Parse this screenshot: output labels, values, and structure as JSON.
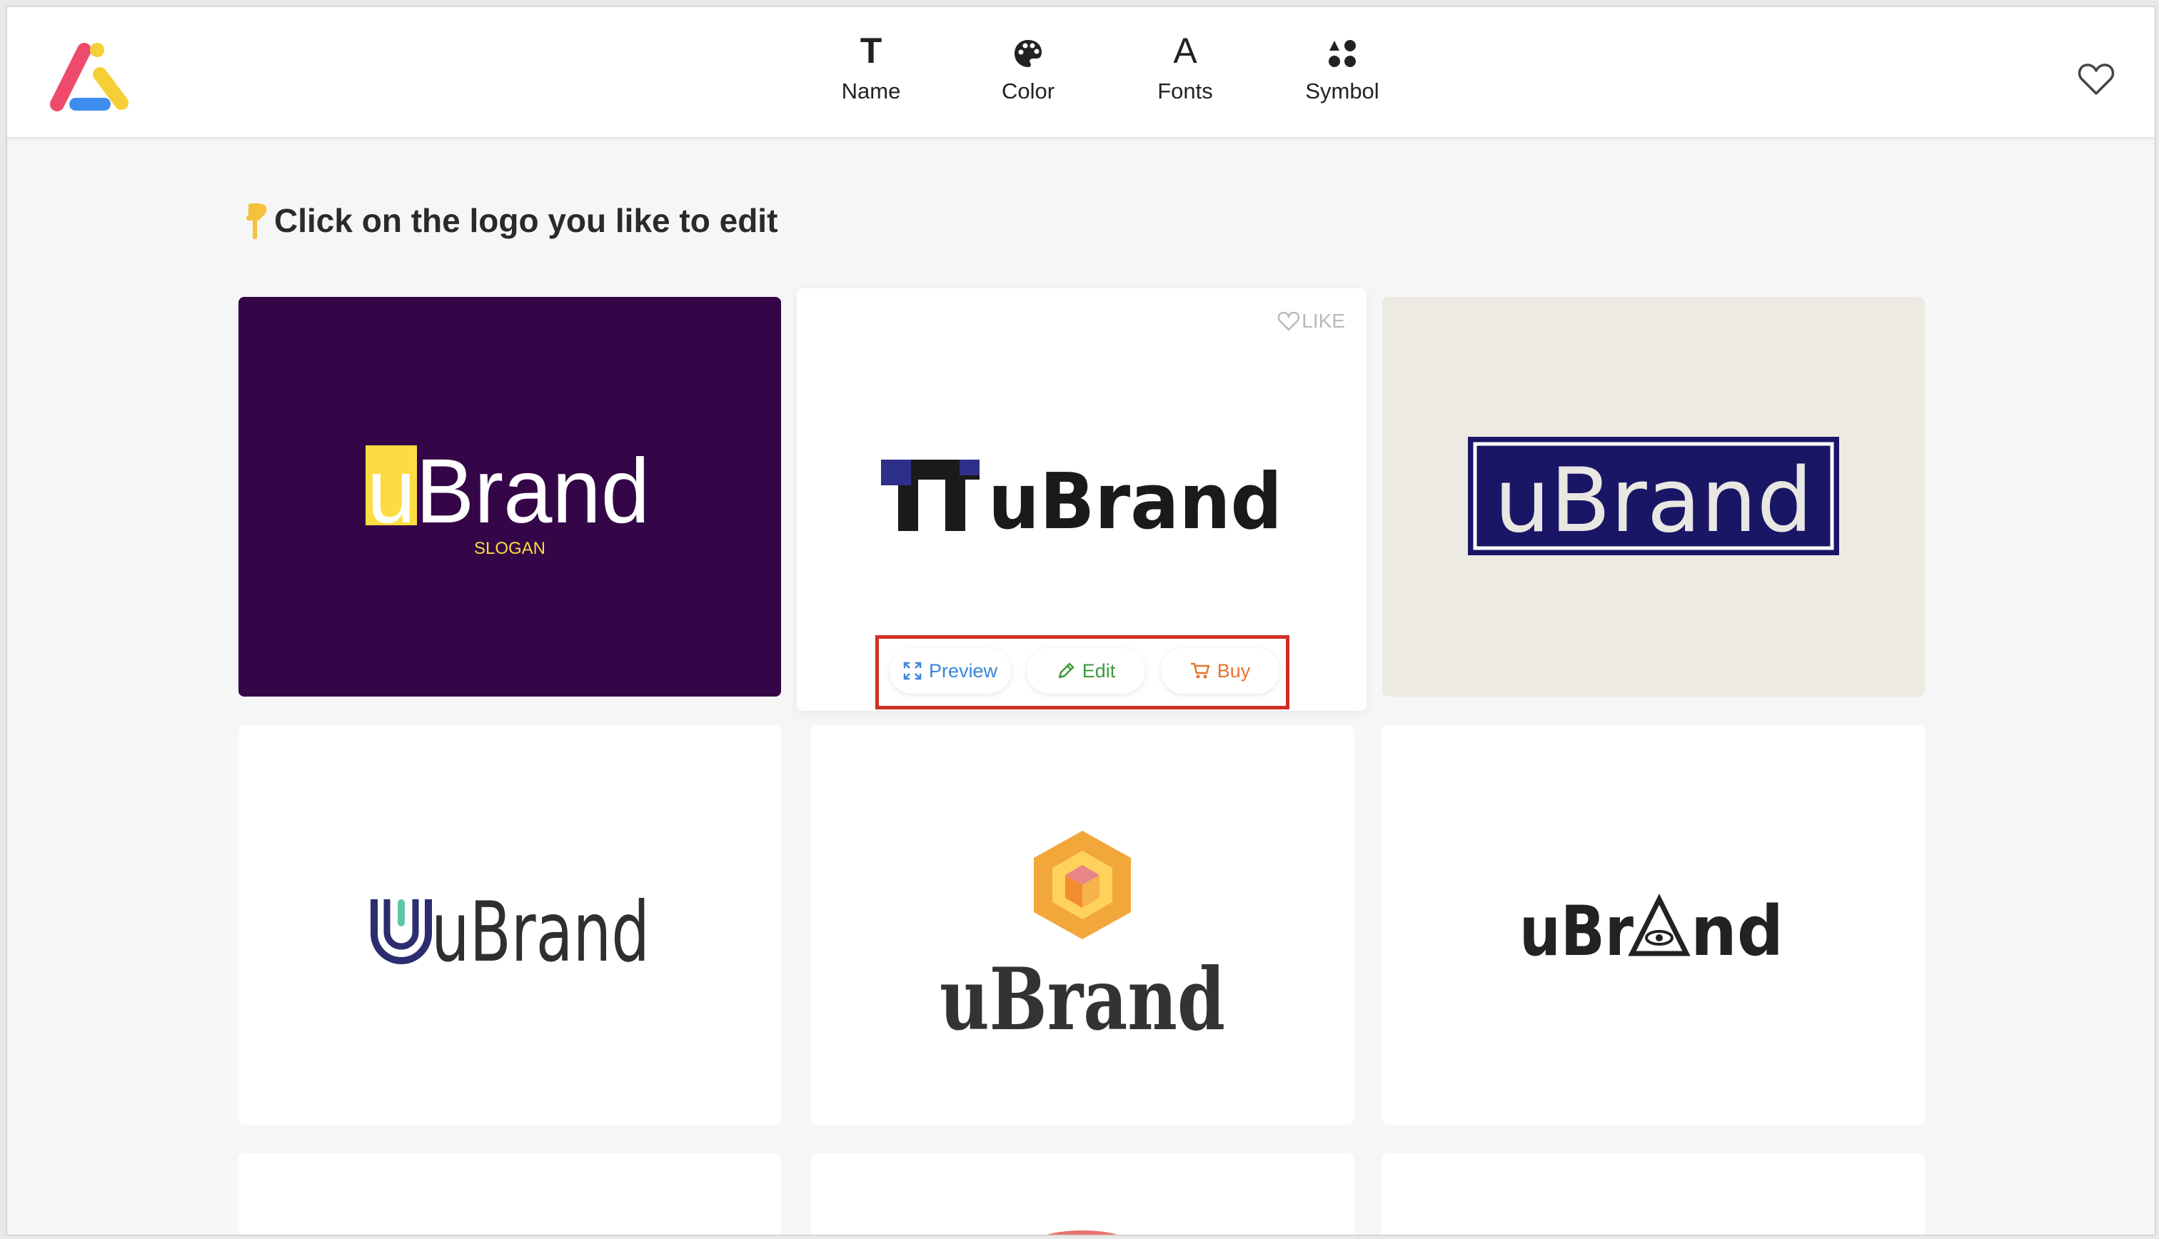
{
  "nav": {
    "items": [
      {
        "label": "Name",
        "icon": "text-icon"
      },
      {
        "label": "Color",
        "icon": "palette-icon"
      },
      {
        "label": "Fonts",
        "icon": "font-icon"
      },
      {
        "label": "Symbol",
        "icon": "shapes-icon"
      }
    ]
  },
  "instruction": "Click on the logo you like to edit",
  "cards": [
    {
      "brand": "uBrand",
      "slogan": "SLOGAN",
      "background": "#350647",
      "accent": "#fcdc43"
    },
    {
      "brand": "uBrand",
      "background": "#ffffff",
      "like_label": "LIKE"
    },
    {
      "brand": "uBrand",
      "background": "#edeae4",
      "accent": "#1a1666"
    },
    {
      "brand": "uBrand",
      "background": "#ffffff"
    },
    {
      "brand": "uBrand",
      "background": "#ffffff",
      "accent": "#f2a73b"
    },
    {
      "brand": "uBr",
      "brand_end": "nd",
      "background": "#ffffff"
    }
  ],
  "card_actions": {
    "preview": "Preview",
    "edit": "Edit",
    "buy": "Buy"
  },
  "colors": {
    "preview": "#3a86d8",
    "edit": "#3c9b3c",
    "buy": "#e8742f",
    "highlight": "#cf2f23"
  }
}
